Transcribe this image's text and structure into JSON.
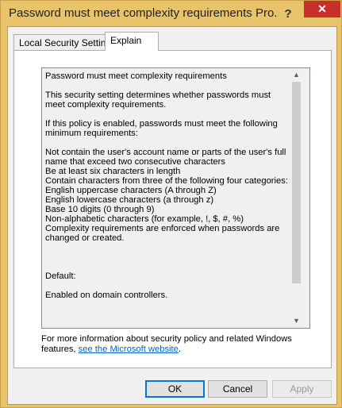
{
  "window": {
    "title": "Password must meet complexity requirements Pro...",
    "help_glyph": "?",
    "close_glyph": "✕"
  },
  "tabs": [
    {
      "label": "Local Security Setting",
      "active": false
    },
    {
      "label": "Explain",
      "active": true
    }
  ],
  "explain": {
    "lines": [
      "Password must meet complexity requirements",
      "",
      "This security setting determines whether passwords must meet complexity requirements.",
      "",
      "If this policy is enabled, passwords must meet the following minimum requirements:",
      "",
      "Not contain the user's account name or parts of the user's full name that exceed two consecutive characters",
      "Be at least six characters in length",
      "Contain characters from three of the following four categories:",
      "English uppercase characters (A through Z)",
      "English lowercase characters (a through z)",
      "Base 10 digits (0 through 9)",
      "Non-alphabetic characters (for example, !, $, #, %)",
      "Complexity requirements are enforced when passwords are changed or created.",
      "",
      "",
      "",
      "Default:",
      "",
      "Enabled on domain controllers."
    ],
    "scroll_up_glyph": "▲",
    "scroll_down_glyph": "▼"
  },
  "more_info": {
    "text": "For more information about security policy and related Windows features, ",
    "link_text": "see the Microsoft website",
    "suffix": "."
  },
  "buttons": {
    "ok": "OK",
    "cancel": "Cancel",
    "apply": "Apply"
  },
  "colors": {
    "title_bar": "#e8c36a",
    "close_button": "#c7302a",
    "link": "#0066cc"
  }
}
